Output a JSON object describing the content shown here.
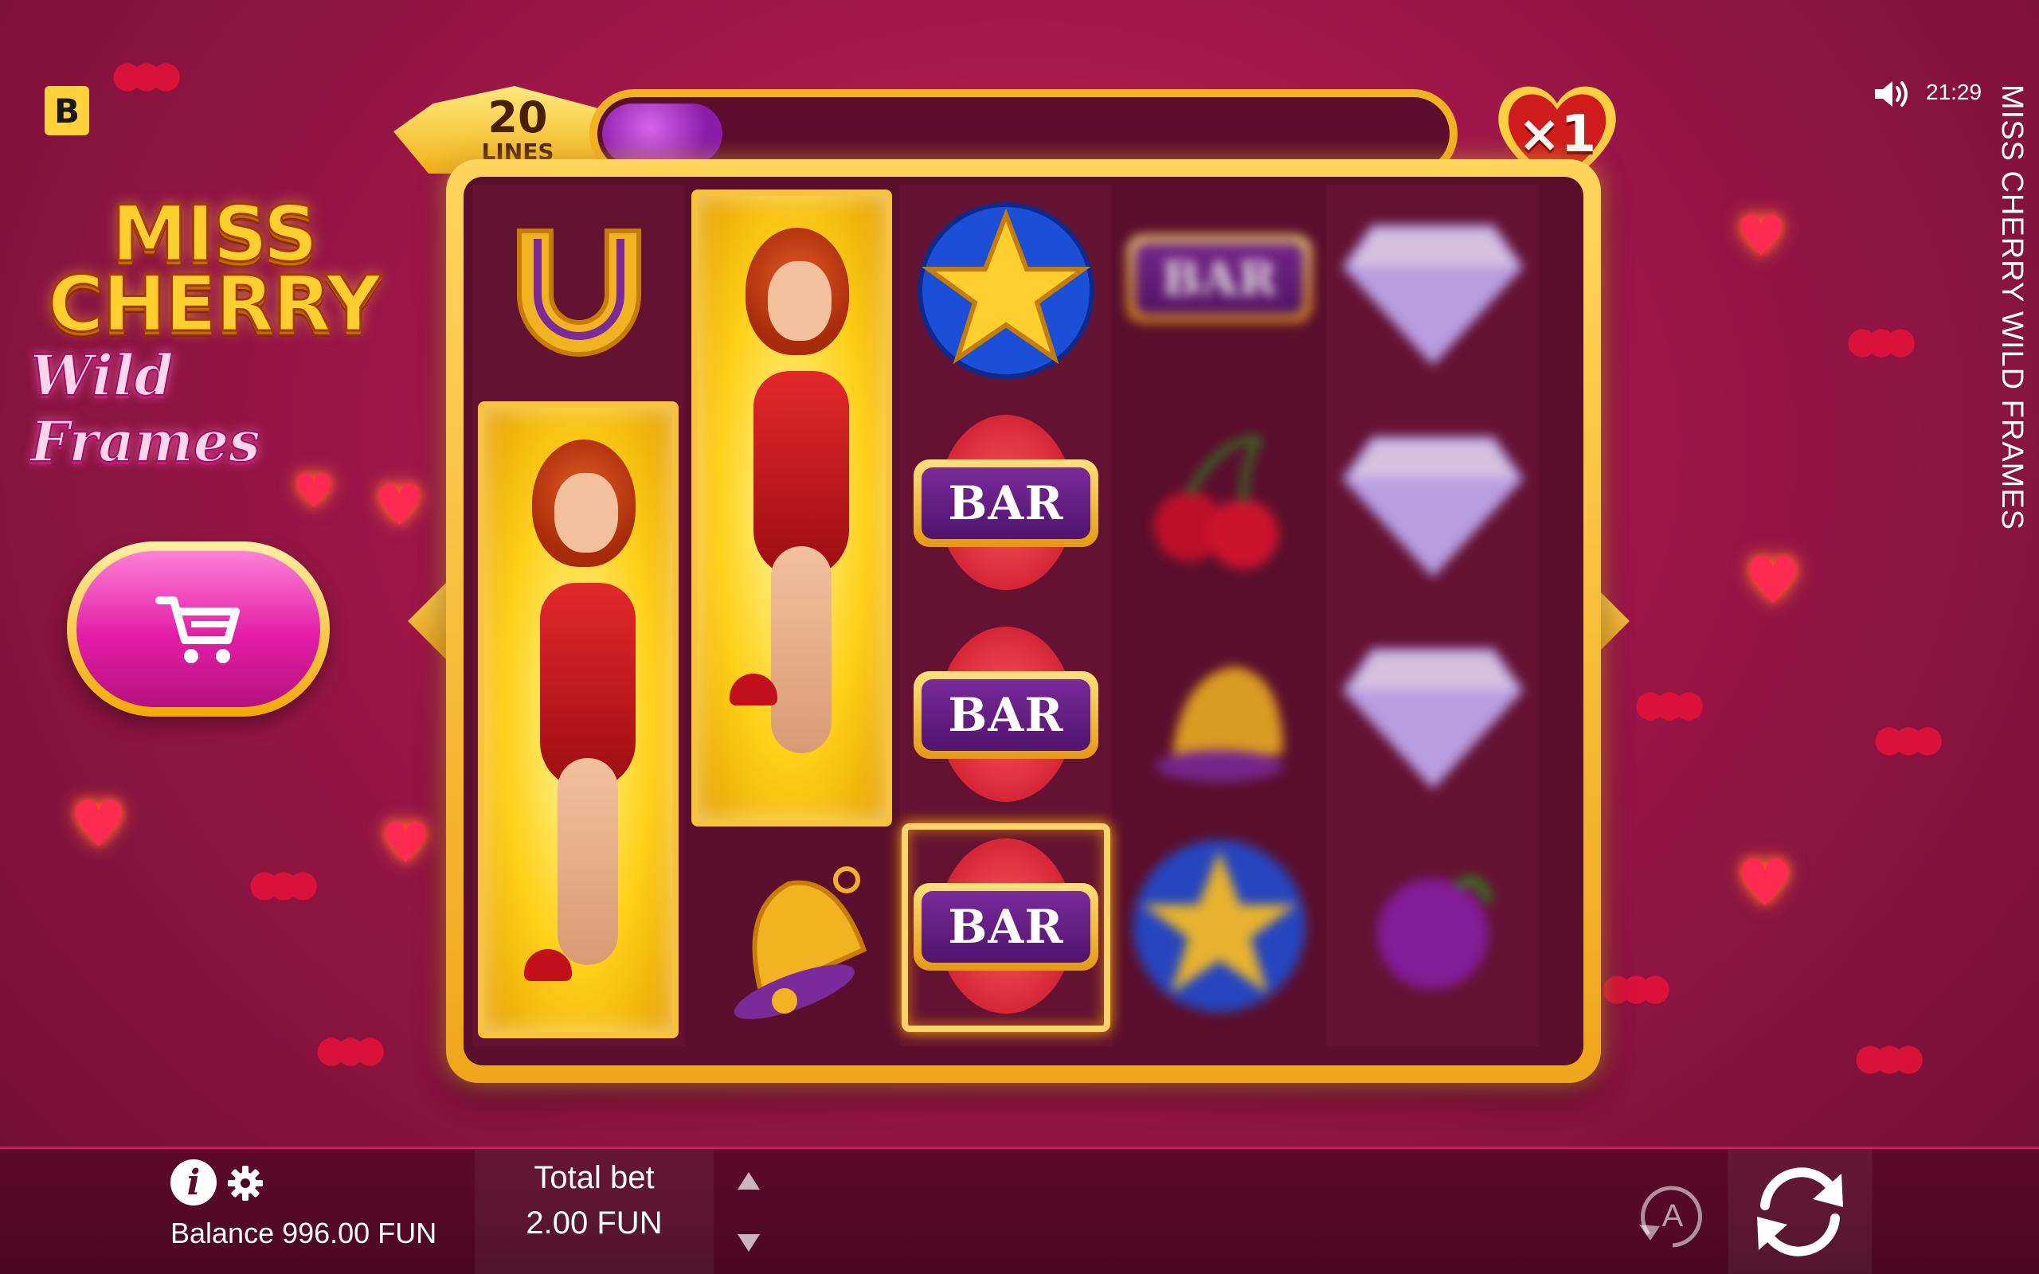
{
  "brand": {
    "letter": "B"
  },
  "logo": {
    "line1": "MISS",
    "line2": "CHERRY",
    "line3": "Wild Frames"
  },
  "status": {
    "time": "21:29",
    "game_title": "MISS CHERRY WILD FRAMES"
  },
  "lines": {
    "count": "20",
    "label": "LINES"
  },
  "progress": {
    "filled_hearts": 2,
    "total_hearts": 14
  },
  "multiplier": {
    "text": "×1"
  },
  "reels": [
    [
      "horseshoe",
      "wild-stack",
      "wild-stack",
      "wild-stack"
    ],
    [
      "wild-stack",
      "wild-stack",
      "wild-stack",
      "bell"
    ],
    [
      "star",
      "BAR",
      "BAR",
      "BAR"
    ],
    [
      "BAR",
      "cherry",
      "bell",
      "star"
    ],
    [
      "diamond",
      "diamond",
      "diamond",
      "plum"
    ]
  ],
  "bar_label": "BAR",
  "footer": {
    "balance_label": "Balance 996.00 FUN",
    "total_bet_label": "Total bet",
    "total_bet_value": "2.00 FUN",
    "autoplay_letter": "A"
  },
  "colors": {
    "background": "#9c1648",
    "frame_gold": "#f2b321",
    "bar_purple": "#50146e",
    "cart_pink": "#e21da6"
  },
  "icons": [
    "brand-icon",
    "cart-icon",
    "sound-icon",
    "info-icon",
    "gear-icon",
    "autoplay-icon",
    "spin-icon",
    "heart-icon",
    "cherry-icon"
  ]
}
